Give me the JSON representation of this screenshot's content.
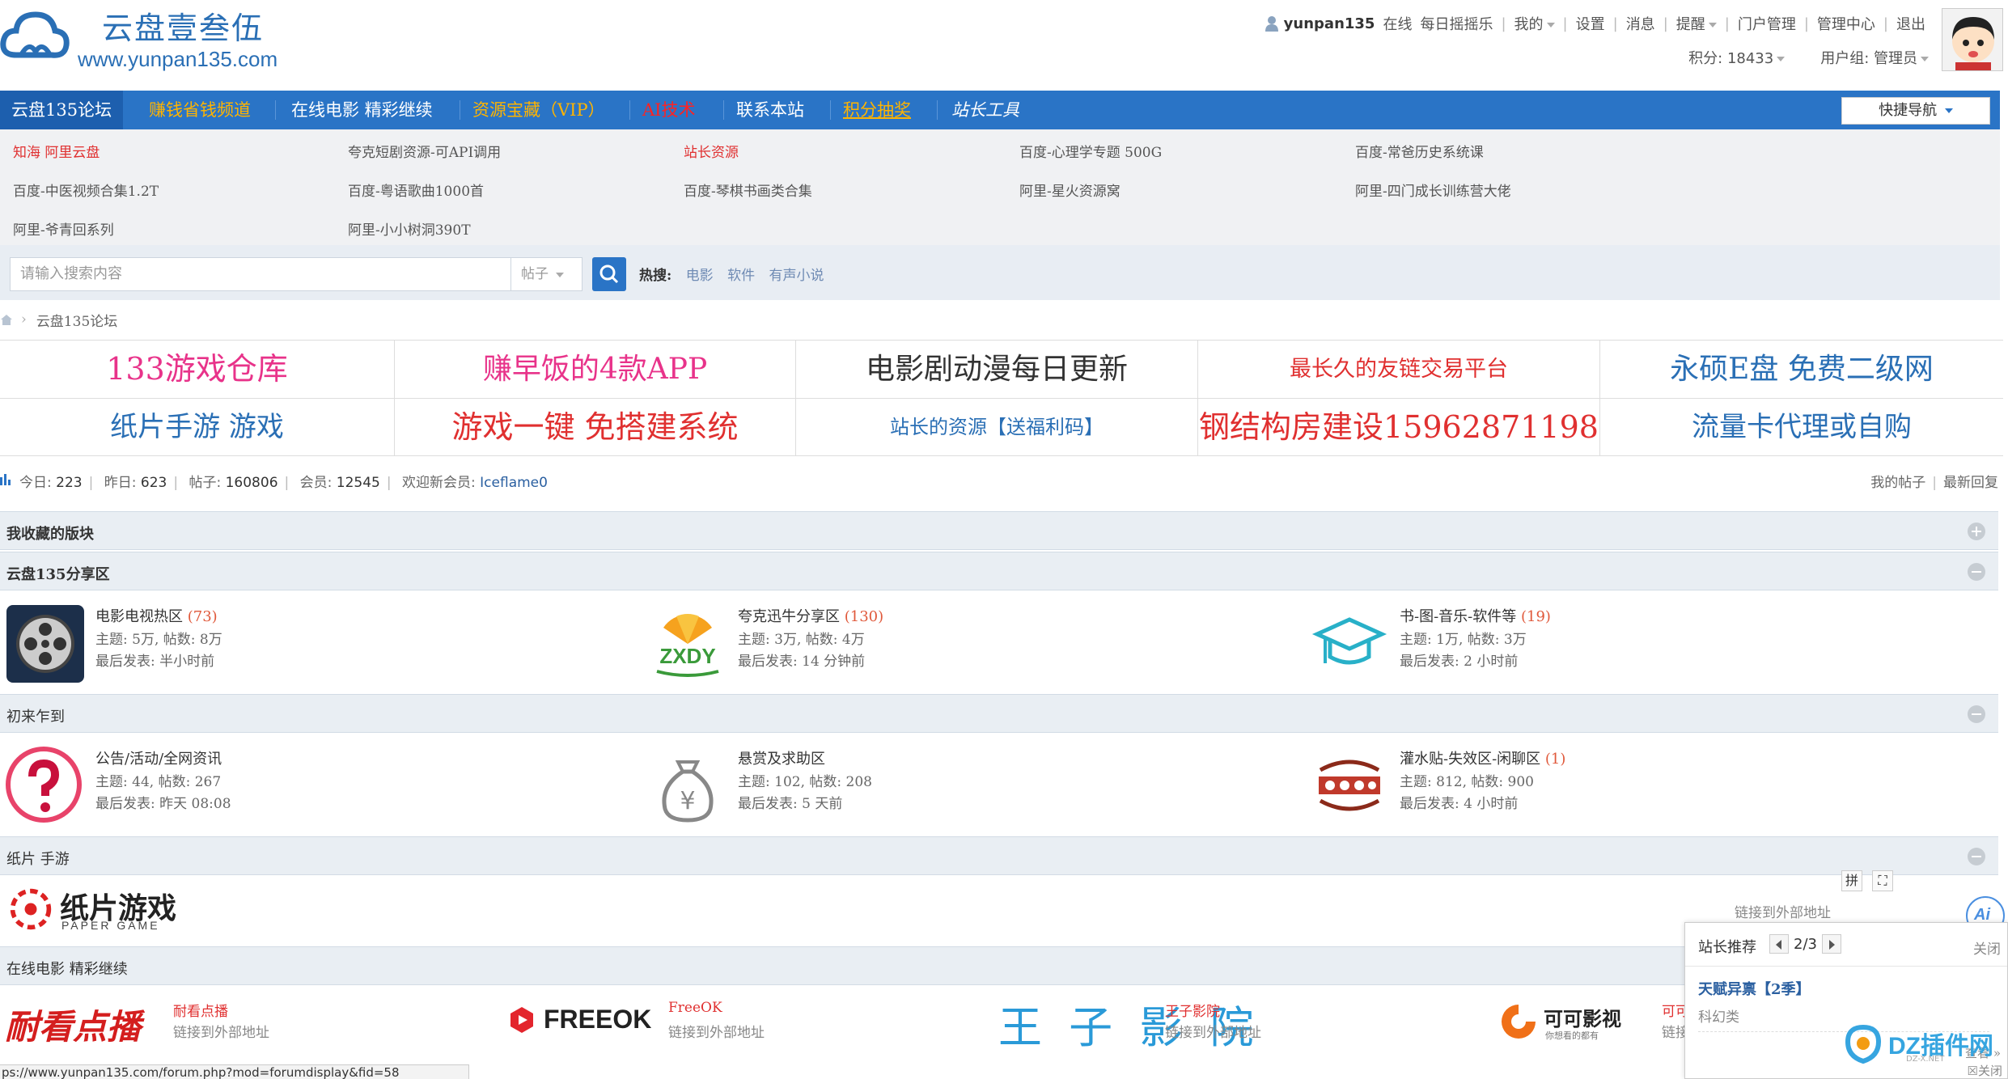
{
  "header": {
    "logo_title": "云盘壹叁伍",
    "logo_url": "www.yunpan135.com",
    "username": "yunpan135",
    "online": "在线",
    "menu": [
      "每日摇摇乐",
      "我的",
      "设置",
      "消息",
      "提醒",
      "门户管理",
      "管理中心",
      "退出"
    ],
    "points": "积分: 18433",
    "usergroup": "用户组: 管理员"
  },
  "nav": {
    "items": [
      {
        "label": "云盘135论坛"
      },
      {
        "label": "赚钱省钱频道"
      },
      {
        "label": "在线电影 精彩继续"
      },
      {
        "label": "资源宝藏（VIP）"
      },
      {
        "label": "AI技术"
      },
      {
        "label": "联系本站"
      },
      {
        "label": "积分抽奖"
      },
      {
        "label": "站长工具"
      }
    ],
    "quick_nav": "快捷导航"
  },
  "links": [
    "知海 阿里云盘",
    "夸克短剧资源-可API调用",
    "站长资源",
    "百度-心理学专题 500G",
    "百度-常爸历史系统课",
    "百度-中医视频合集1.2T",
    "百度-粤语歌曲1000首",
    "百度-琴棋书画类合集",
    "阿里-星火资源窝",
    "阿里-四门成长训练营大佬",
    "阿里-爷青回系列",
    "阿里-小小树洞390T"
  ],
  "search": {
    "placeholder": "请输入搜索内容",
    "type": "帖子",
    "hot_label": "热搜:",
    "hot_words": [
      "电影",
      "软件",
      "有声小说"
    ]
  },
  "breadcrumb": {
    "arrow": "›",
    "current": "云盘135论坛"
  },
  "ads": [
    {
      "text": "133游戏仓库",
      "color": "#e8338a"
    },
    {
      "text": "赚早饭的4款APP",
      "color": "#e8338a"
    },
    {
      "text": "电影剧动漫每日更新",
      "color": "#333333"
    },
    {
      "text": "最长久的友链交易平台",
      "color": "#e03030"
    },
    {
      "text": "永硕E盘 免费二级网",
      "color": "#2a6fb5"
    },
    {
      "text": "纸片手游 游戏",
      "color": "#2a6fb5"
    },
    {
      "text": "游戏一键  免搭建系统",
      "color": "#e03030"
    },
    {
      "text": "站长的资源【送福利码】",
      "color": "#2a6fb5"
    },
    {
      "text": "钢结构房建设15962871198",
      "color": "#e03030"
    },
    {
      "text": "流量卡代理或自购",
      "color": "#2a6fb5"
    }
  ],
  "stats": {
    "today_label": "今日:",
    "today": "223",
    "yesterday_label": "昨日:",
    "yesterday": "623",
    "posts_label": "帖子:",
    "posts": "160806",
    "members_label": "会员:",
    "members": "12545",
    "newest_label": "欢迎新会员:",
    "newest": "Iceflame0",
    "my_posts": "我的帖子",
    "latest_replies": "最新回复"
  },
  "sections": {
    "fav": "我收藏的版块",
    "share": "云盘135分享区",
    "newbie": "初来乍到",
    "paper": "纸片 手游",
    "movie": "在线电影 精彩继续"
  },
  "forums_share": [
    {
      "name": "电影电视热区",
      "count": "(73)",
      "topics": "主题: 5万, 帖数: 8万",
      "last": "最后发表: 半小时前"
    },
    {
      "name": "夸克迅牛分享区",
      "count": "(130)",
      "topics": "主题: 3万, 帖数: 4万",
      "last": "最后发表: 14 分钟前"
    },
    {
      "name": "书-图-音乐-软件等",
      "count": "(19)",
      "topics": "主题: 1万, 帖数: 3万",
      "last": "最后发表: 2 小时前"
    }
  ],
  "forums_newbie": [
    {
      "name": "公告/活动/全网资讯",
      "count": "",
      "topics": "主题: 44, 帖数: 267",
      "last": "最后发表: 昨天 08:08"
    },
    {
      "name": "悬赏及求助区",
      "count": "",
      "topics": "主题: 102, 帖数: 208",
      "last": "最后发表: 5 天前"
    },
    {
      "name": "灌水贴-失效区-闲聊区",
      "count": "(1)",
      "topics": "主题: 812, 帖数: 900",
      "last": "最后发表: 4 小时前"
    }
  ],
  "paper": {
    "logo_cn": "纸片游戏",
    "logo_en": "PAPER GAME",
    "ext_link": "链接到外部地址"
  },
  "movie_links": [
    {
      "logo": "耐看点播",
      "name": "耐看点播",
      "sub": "链接到外部地址"
    },
    {
      "logo": "FREEOK",
      "name": "FreeOK",
      "sub": "链接到外部地址"
    },
    {
      "logo": "王 子 影 院",
      "name": "王子影院",
      "sub": "链接到外部地址"
    },
    {
      "logo": "可可影视",
      "logo_sub": "你想看的都有",
      "name": "可可",
      "sub": "链接"
    }
  ],
  "statusbar": "ps://www.yunpan135.com/forum.php?mod=forumdisplay&fid=58",
  "popup": {
    "title": "站长推荐",
    "page": "2/3",
    "close": "关闭",
    "item_title": "天赋异禀【2季】",
    "item_cat": "科幻类",
    "more": "查看 »",
    "close2": "☒关闭"
  },
  "mini_tools": [
    "拼",
    "⛶"
  ],
  "ai_label": "Ai",
  "dz_badge": {
    "text": "DZ插件网",
    "sub": "DZ-X.NET"
  }
}
